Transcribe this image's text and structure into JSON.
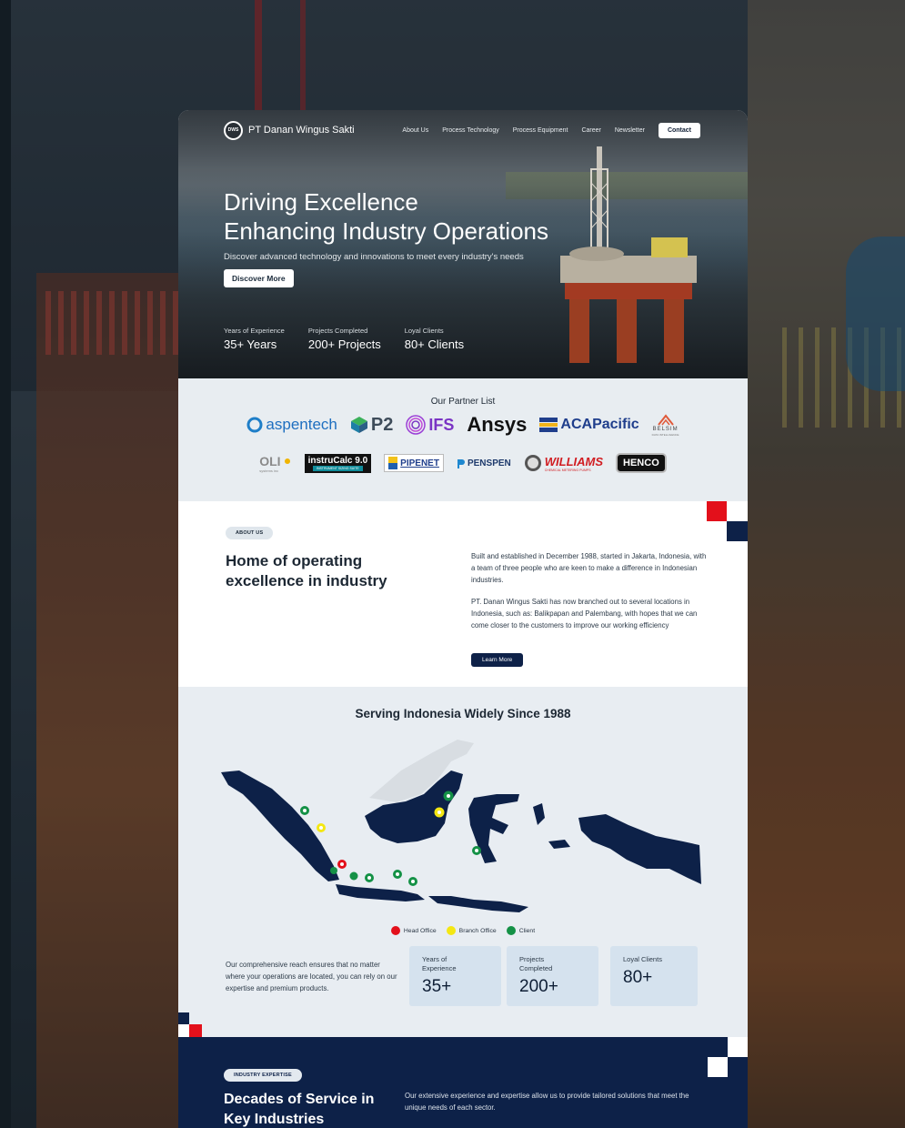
{
  "nav": {
    "logo_badge": "DWS",
    "company": "PT Danan Wingus Sakti",
    "links": [
      "About Us",
      "Process Technology",
      "Process Equipment",
      "Career",
      "Newsletter"
    ],
    "contact": "Contact"
  },
  "hero": {
    "title_line1": "Driving Excellence",
    "title_line2": "Enhancing Industry Operations",
    "subtitle": "Discover advanced technology and innovations to meet every industry's needs",
    "button": "Discover More",
    "stats": [
      {
        "label": "Years of Experience",
        "value": "35+ Years"
      },
      {
        "label": "Projects Completed",
        "value": "200+ Projects"
      },
      {
        "label": "Loyal Clients",
        "value": "80+ Clients"
      }
    ]
  },
  "partners": {
    "title": "Our Partner List",
    "row1": [
      "aspentech",
      "P2",
      "IFS",
      "Ansys",
      "ACAPacific",
      "BELSIM"
    ],
    "row1_belsim_sub": "DATA INTELLIGENCE",
    "row2": [
      "OLI",
      "instruCalc 9.0",
      "PIPENET",
      "PENSPEN",
      "WILLIAMS",
      "HENCO"
    ],
    "oli_sub": "systems inc",
    "instrucalc_sub": "INSTRUMENT SIZING SUITE",
    "williams_sub": "CHEMICAL METERING PUMPS"
  },
  "about": {
    "chip": "ABOUT US",
    "title_line1": "Home of operating",
    "title_line2": "excellence in industry",
    "p1": "Built and established in December 1988, started in Jakarta, Indonesia, with a team of three people who are keen to make a difference in Indonesian industries.",
    "p2": "PT. Danan Wingus Sakti has now branched out to several locations in Indonesia, such as: Balikpapan and Palembang, with hopes that we can come closer to the customers to improve our working efficiency",
    "button": "Learn More"
  },
  "coverage": {
    "title": "Serving Indonesia Widely Since 1988",
    "legend": [
      {
        "label": "Head Office",
        "color": "#e3101b"
      },
      {
        "label": "Branch Office",
        "color": "#f4e713"
      },
      {
        "label": "Client",
        "color": "#149146"
      }
    ],
    "reach_text": "Our comprehensive reach ensures that no matter where your operations are located, you can rely on our expertise and premium products.",
    "stats": [
      {
        "label": "Years of Experience",
        "value": "35+"
      },
      {
        "label": "Projects Completed",
        "value": "200+"
      },
      {
        "label": "Loyal Clients",
        "value": "80+"
      }
    ]
  },
  "expertise": {
    "chip": "INDUSTRY EXPERTISE",
    "title_line1": "Decades of Service in",
    "title_line2": "Key Industries",
    "text": "Our extensive experience and expertise allow us to provide tailored solutions that meet the unique needs of each sector."
  },
  "colors": {
    "navy": "#0d2148",
    "accent_red": "#e3101b",
    "light_panel": "#e8edf2",
    "stat_box": "#d5e2ee"
  }
}
